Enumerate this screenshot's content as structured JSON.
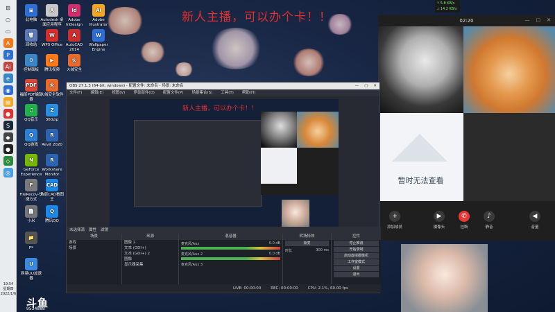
{
  "banner": {
    "text": "新人主播，可以办个卡！！"
  },
  "network": {
    "up": "↑ 5.8 KB/s",
    "down": "↓ 14.2 KB/s"
  },
  "taskbar": {
    "time": "19:54",
    "weekday": "星期四",
    "date": "2022/1/6"
  },
  "desktop_icons": [
    {
      "label": "此电脑",
      "color": "#2f6fd6",
      "glyph": "▣"
    },
    {
      "label": "回收站",
      "color": "#5a7bb8",
      "glyph": "🗑"
    },
    {
      "label": "控制面板",
      "color": "#3a87c8",
      "glyph": "⚙"
    },
    {
      "label": "福昕PDF编辑器",
      "color": "#d84a3a",
      "glyph": "PDF"
    },
    {
      "label": "QQ音乐",
      "color": "#22b14c",
      "glyph": "♫"
    },
    {
      "label": "QQ游戏",
      "color": "#2d7fd6",
      "glyph": "Q"
    },
    {
      "label": "GeForce Experience",
      "color": "#76b900",
      "glyph": "N"
    },
    {
      "label": "FileRecov-快捷方式",
      "color": "#7a7a7a",
      "glyph": "F"
    },
    {
      "label": "小米",
      "color": "#777",
      "glyph": "📄"
    },
    {
      "label": "ps",
      "color": "#555",
      "glyph": "📁"
    },
    {
      "label": "网易UU加速器",
      "color": "#3a8ae0",
      "glyph": "U"
    },
    {
      "label": "Autodesk 桌面应用程序",
      "color": "#c8c8c8",
      "glyph": "A"
    },
    {
      "label": "WPS Office",
      "color": "#d32f2f",
      "glyph": "W"
    },
    {
      "label": "腾讯视频",
      "color": "#ff7a18",
      "glyph": "▶"
    },
    {
      "label": "Adobe InDesign",
      "color": "#d0306a",
      "glyph": "Id"
    },
    {
      "label": "AutoCAD 2014",
      "color": "#c8302f",
      "glyph": "A"
    },
    {
      "label": "火绒安全",
      "color": "#e86a2c",
      "glyph": "火"
    },
    {
      "label": "Adobe Illustrator",
      "color": "#f5a623",
      "glyph": "Ai"
    },
    {
      "label": "Wallpaper Engine",
      "color": "#2d6fd6",
      "glyph": "W"
    },
    {
      "label": "火绒安全软件",
      "color": "#e86a2c",
      "glyph": "火"
    },
    {
      "label": "360zip",
      "color": "#2b8fe0",
      "glyph": "Z"
    },
    {
      "label": "Revit 2020",
      "color": "#2c64b2",
      "glyph": "R"
    },
    {
      "label": "Workshare Monitor",
      "color": "#2c64b2",
      "glyph": "R"
    },
    {
      "label": "浩辰CAD看图王",
      "color": "#1e88e5",
      "glyph": "CAD"
    },
    {
      "label": "腾讯QQ",
      "color": "#1e88e5",
      "glyph": "Q"
    }
  ],
  "call": {
    "time": "02:20",
    "no_view_text": "暂时无法查看",
    "buttons": [
      {
        "label": "添加成员",
        "glyph": "+",
        "color": "#3a3a3a"
      },
      {
        "label": "摄像头",
        "glyph": "▶",
        "color": "#3a3a3a"
      },
      {
        "label": "挂断",
        "glyph": "✆",
        "color": "#e53935"
      },
      {
        "label": "静音",
        "glyph": "♪",
        "color": "#3a3a3a"
      },
      {
        "label": "音量",
        "glyph": "◀",
        "color": "#3a3a3a"
      }
    ]
  },
  "obs": {
    "title": "OBS 27.1.3 (64-bit, windows) - 配置文件: 未命名 - 场景: 未命名",
    "menu": [
      "文件(F)",
      "编辑(E)",
      "视图(V)",
      "停靠部件(D)",
      "配置文件(P)",
      "场景集合(S)",
      "工具(T)",
      "帮助(H)"
    ],
    "scene_strip": [
      "未选择源",
      "属性",
      "滤镜"
    ],
    "panels": {
      "scenes": {
        "title": "场景",
        "items": [
          "游戏",
          "场景"
        ]
      },
      "sources": {
        "title": "来源",
        "items": [
          "图像 2",
          "文本 (GDI+)",
          "文本 (GDI+) 2",
          "图像",
          "显示器采集"
        ]
      },
      "mixer": {
        "title": "混音器",
        "rows": [
          {
            "name": "麦克风/Aux",
            "db": "0.0 dB"
          },
          {
            "name": "麦克风/Aux 2",
            "db": "0.0 dB"
          },
          {
            "name": "麦克风/Aux 3",
            "db": ""
          }
        ]
      },
      "transitions": {
        "title": "转场特效",
        "mode": "渐变",
        "duration_label": "时长",
        "duration": "300 ms"
      },
      "controls": {
        "title": "控件",
        "buttons": [
          "停止推流",
          "开始录制",
          "启动虚拟摄像机",
          "工作室模式",
          "设置",
          "退出"
        ]
      }
    },
    "status": {
      "live": "LIVE: 00:00:00",
      "rec": "REC: 00:00:00",
      "cpu": "CPU: 2.1%, 60.00 fps"
    }
  },
  "watermark": {
    "logo": "斗鱼",
    "room": "9534888"
  }
}
